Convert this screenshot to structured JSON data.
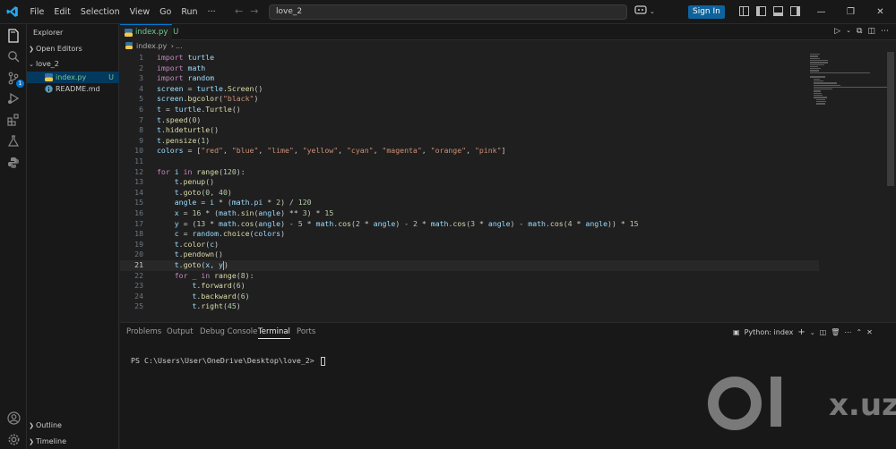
{
  "window": {
    "menu": [
      "File",
      "Edit",
      "Selection",
      "View",
      "Go",
      "Run"
    ],
    "more": "···",
    "command_center": "love_2",
    "signin_label": "Sign In"
  },
  "sidebar": {
    "title": "Explorer",
    "open_editors": "Open Editors",
    "folder": "love_2",
    "files": [
      {
        "name": "index.py",
        "status": "U"
      },
      {
        "name": "README.md"
      }
    ],
    "outline": "Outline",
    "timeline": "Timeline"
  },
  "tabs": [
    {
      "label": "index.py",
      "status": "U"
    }
  ],
  "breadcrumb": {
    "file": "index.py",
    "more": "..."
  },
  "activity": {
    "source_control_badge": "1"
  },
  "editor": {
    "active_line": 21,
    "lines": [
      "import turtle",
      "import math",
      "import random",
      "screen = turtle.Screen()",
      "screen.bgcolor(\"black\")",
      "t = turtle.Turtle()",
      "t.speed(0)",
      "t.hideturtle()",
      "t.pensize(1)",
      "colors = [\"red\", \"blue\", \"lime\", \"yellow\", \"cyan\", \"magenta\", \"orange\", \"pink\"]",
      "",
      "for i in range(120):",
      "    t.penup()",
      "    t.goto(0, 40)",
      "    angle = i * (math.pi * 2) / 120",
      "    x = 16 * (math.sin(angle) ** 3) * 15",
      "    y = (13 * math.cos(angle) - 5 * math.cos(2 * angle) - 2 * math.cos(3 * angle) - math.cos(4 * angle)) * 15",
      "    c = random.choice(colors)",
      "    t.color(c)",
      "    t.pendown()",
      "    t.goto(x, y)",
      "    for _ in range(8):",
      "        t.forward(6)",
      "        t.backward(6)",
      "        t.right(45)"
    ]
  },
  "panel": {
    "tabs": [
      "Problems",
      "Output",
      "Debug Console",
      "Terminal",
      "Ports"
    ],
    "active_tab": "Terminal",
    "terminal_name": "Python: index",
    "prompt": "PS C:\\Users\\User\\OneDrive\\Desktop\\love_2> "
  },
  "watermark": {
    "text": "x.uz"
  },
  "colors": {
    "accent": "#0078d4",
    "keyword": "#c586c0",
    "string": "#ce9178",
    "number": "#b5cea8",
    "function": "#dcdcaa"
  }
}
